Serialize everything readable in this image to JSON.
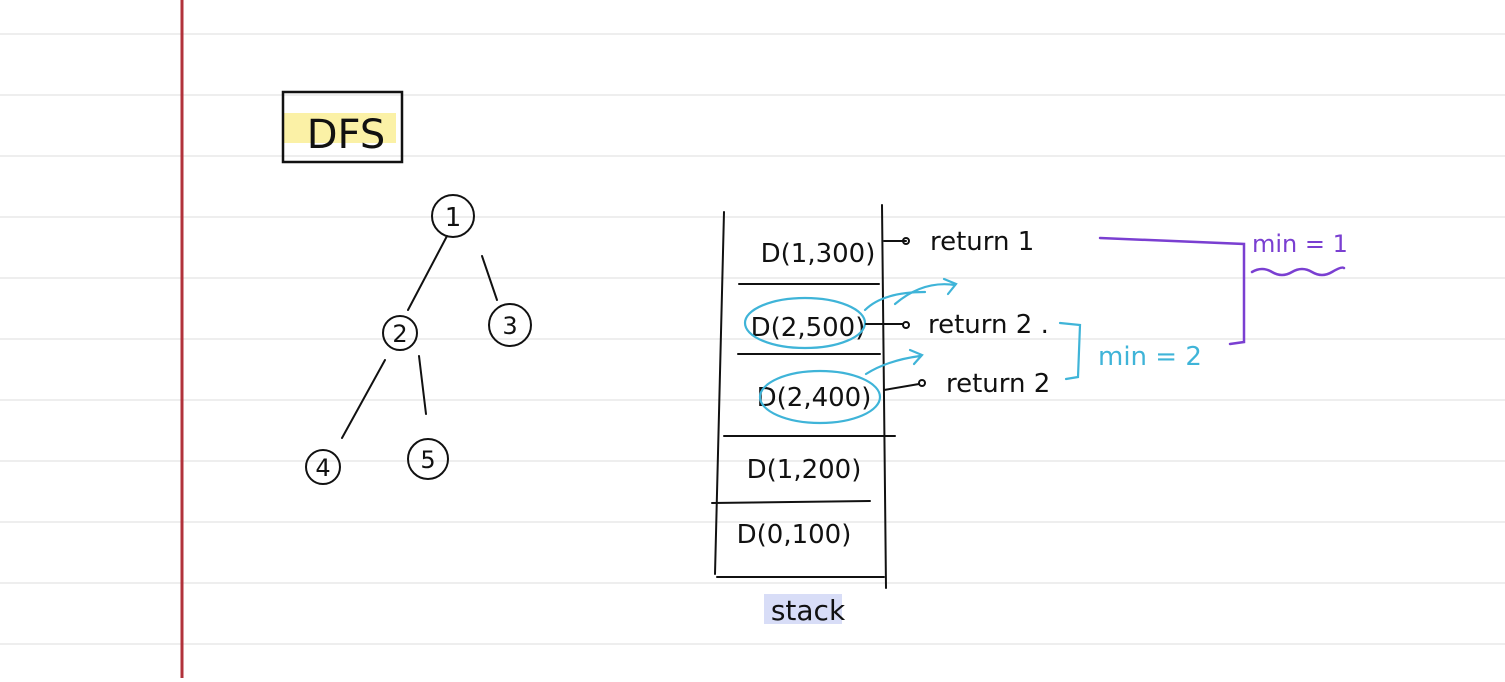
{
  "colors": {
    "paper": "#ffffff",
    "rule": "#dcdcdc",
    "margin": "#b1323b",
    "ink": "#111111",
    "highlight_yellow": "#fbf1a6",
    "highlight_blue": "#d8ddf7",
    "annot_cyan": "#3fb4d8",
    "annot_purple": "#7a3fd1"
  },
  "title": "DFS",
  "tree": {
    "nodes": [
      "1",
      "2",
      "3",
      "4",
      "5"
    ]
  },
  "stack": {
    "label": "stack",
    "frames": [
      "D(1,300)",
      "D(2,500)",
      "D(2,400)",
      "D(1,200)",
      "D(0,100)"
    ]
  },
  "returns": [
    "return 1",
    "return 2 .",
    "return 2"
  ],
  "annotations": {
    "min_blue": "min = 2",
    "min_purple": "min = 1"
  }
}
